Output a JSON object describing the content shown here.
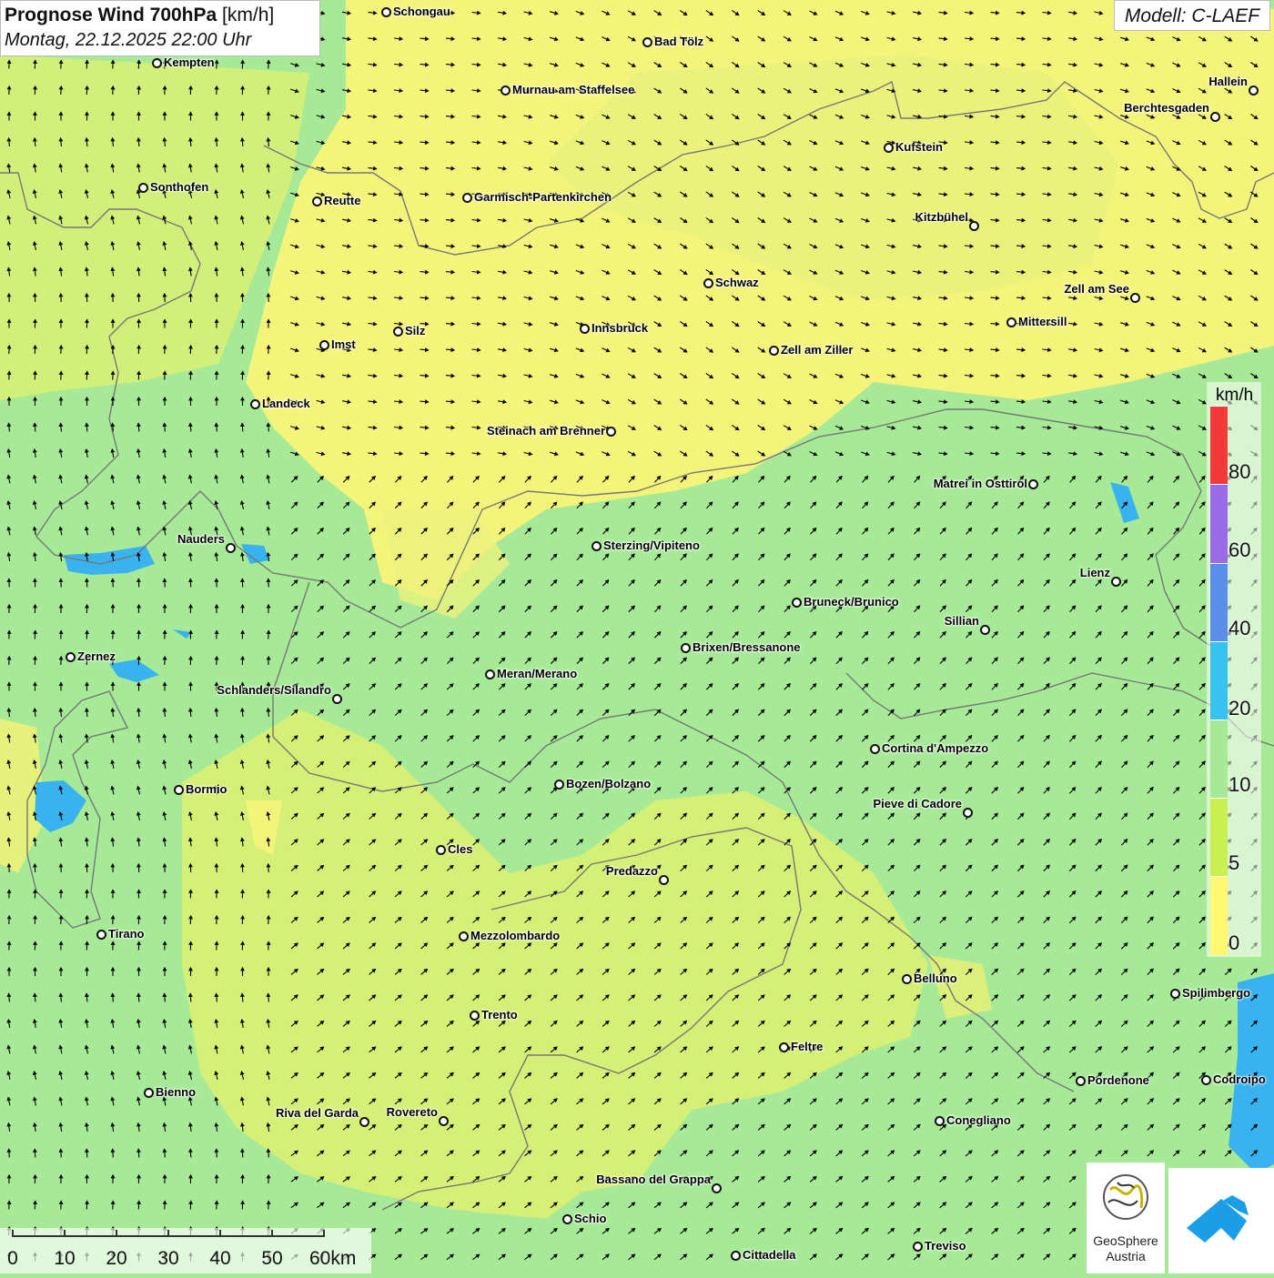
{
  "header": {
    "title_bold": "Prognose Wind 700hPa",
    "title_unit": " [km/h]",
    "subtitle": "Montag, 22.12.2025 22:00 Uhr"
  },
  "model_label": "Modell: C-LAEF",
  "legend": {
    "unit": "km/h",
    "ticks": [
      "80",
      "60",
      "40",
      "20",
      "10",
      "5",
      "0"
    ],
    "colors": [
      "#f23a3a",
      "#9a6ae8",
      "#5a8ee8",
      "#36c3f0",
      "#a6ea98",
      "#c8f050",
      "#fff870"
    ]
  },
  "scale_bar": {
    "labels": [
      "0",
      "10",
      "20",
      "30",
      "40",
      "50",
      "60km"
    ]
  },
  "logo": {
    "org_line1": "GeoSphere",
    "org_line2": "Austria"
  },
  "colors": {
    "calm_yellow": "#f8f57a",
    "light_green": "#a6ea98",
    "lime": "#d9f074",
    "blue_strong": "#38b3f0",
    "border_gray": "#777777",
    "logo_blue": "#1a9ee8"
  },
  "cities": [
    {
      "name": "Schongau"
    },
    {
      "name": "Bad Tölz"
    },
    {
      "name": "Kempten"
    },
    {
      "name": "Murnau am Staffelsee"
    },
    {
      "name": "Hallein"
    },
    {
      "name": "Berchtesgaden"
    },
    {
      "name": "Kufstein"
    },
    {
      "name": "Sonthofen"
    },
    {
      "name": "Reutte"
    },
    {
      "name": "Garmisch-Partenkirchen"
    },
    {
      "name": "Kitzbühel"
    },
    {
      "name": "Schwaz"
    },
    {
      "name": "Zell am See"
    },
    {
      "name": "Mittersill"
    },
    {
      "name": "Innsbruck"
    },
    {
      "name": "Silz"
    },
    {
      "name": "Imst"
    },
    {
      "name": "Zell am Ziller"
    },
    {
      "name": "Landeck"
    },
    {
      "name": "Steinach am Brenner"
    },
    {
      "name": "Matrei in Osttirol"
    },
    {
      "name": "Nauders"
    },
    {
      "name": "Sterzing/Vipiteno"
    },
    {
      "name": "Lienz"
    },
    {
      "name": "Bruneck/Brunico"
    },
    {
      "name": "Sillian"
    },
    {
      "name": "Brixen/Bressanone"
    },
    {
      "name": "Zernez"
    },
    {
      "name": "Meran/Merano"
    },
    {
      "name": "Schlanders/Silandro"
    },
    {
      "name": "Cortina d'Ampezzo"
    },
    {
      "name": "Bozen/Bolzano"
    },
    {
      "name": "Bormio"
    },
    {
      "name": "Pieve di Cadore"
    },
    {
      "name": "Cles"
    },
    {
      "name": "Predazzo"
    },
    {
      "name": "Tirano"
    },
    {
      "name": "Mezzolombardo"
    },
    {
      "name": "Belluno"
    },
    {
      "name": "Spilimbergo"
    },
    {
      "name": "Trento"
    },
    {
      "name": "Feltre"
    },
    {
      "name": "Bienno"
    },
    {
      "name": "Pordenone"
    },
    {
      "name": "Codroipo"
    },
    {
      "name": "Riva del Garda"
    },
    {
      "name": "Rovereto"
    },
    {
      "name": "Conegliano"
    },
    {
      "name": "Bassano del Grappa"
    },
    {
      "name": "Schio"
    },
    {
      "name": "Treviso"
    },
    {
      "name": "Cittadella"
    }
  ]
}
